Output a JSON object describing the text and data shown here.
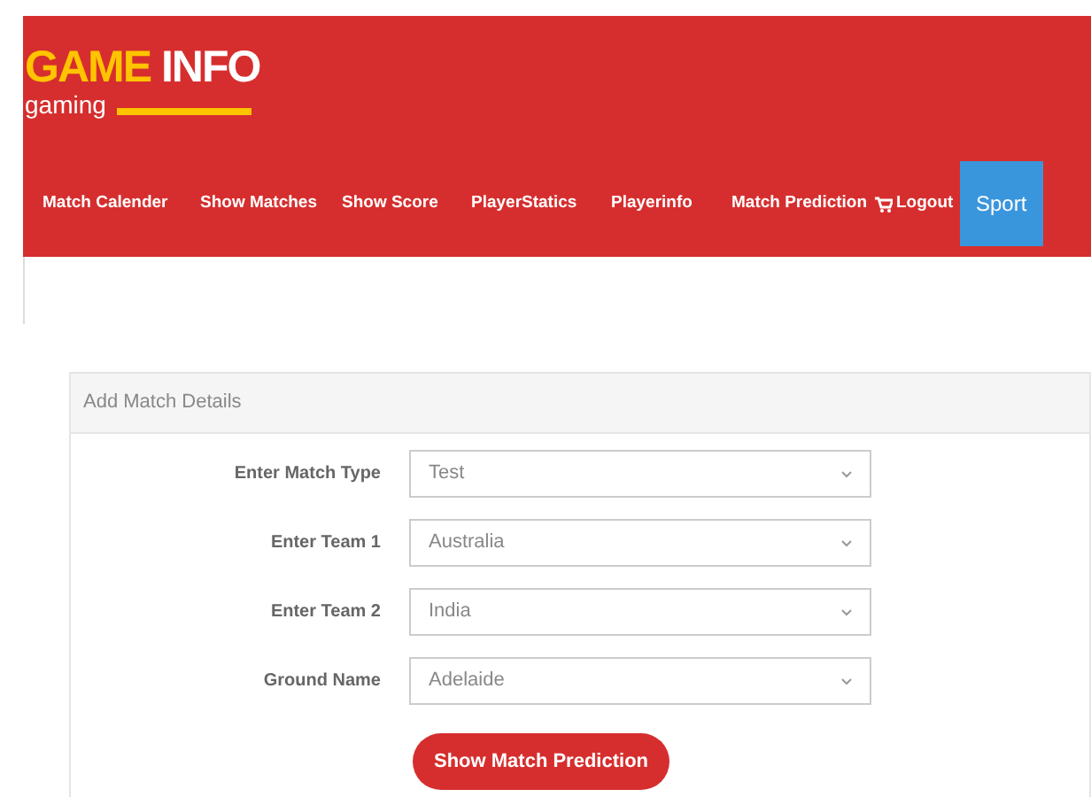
{
  "logo": {
    "highlight": "GAME",
    "rest": "INFO",
    "tagline": "gaming"
  },
  "nav": [
    {
      "label": "Match Calender",
      "kind": "link"
    },
    {
      "label": "Show Matches",
      "kind": "link"
    },
    {
      "label": "Show Score",
      "kind": "link"
    },
    {
      "label": "PlayerStatics",
      "kind": "link"
    },
    {
      "label": "Playerinfo",
      "kind": "link"
    },
    {
      "label": "Match Prediction",
      "kind": "link"
    },
    {
      "label": "Logout",
      "kind": "cart"
    },
    {
      "label": "Sport",
      "kind": "button"
    }
  ],
  "card": {
    "title": "Add Match Details",
    "fields": [
      {
        "label": "Enter Match Type",
        "value": "Test"
      },
      {
        "label": "Enter Team 1",
        "value": "Australia"
      },
      {
        "label": "Enter Team 2",
        "value": "India"
      },
      {
        "label": "Ground Name",
        "value": "Adelaide"
      }
    ],
    "submit": "Show Match Prediction"
  }
}
